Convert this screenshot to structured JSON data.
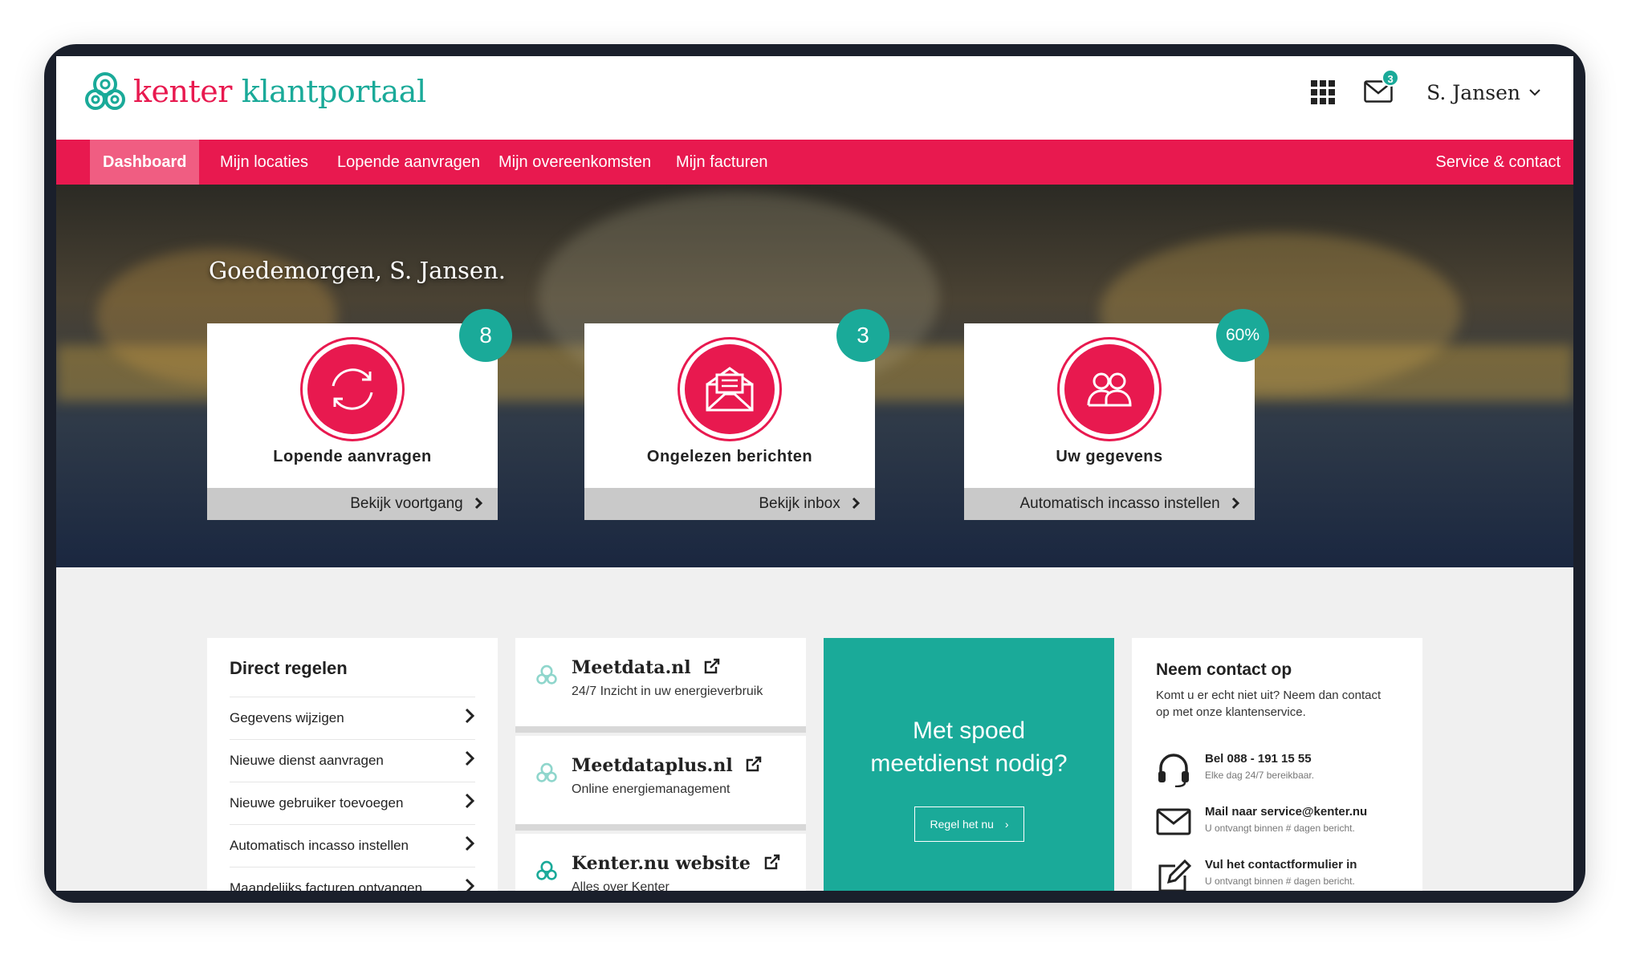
{
  "header": {
    "logo_part1": "kenter",
    "logo_part2": "klantportaal",
    "mail_count": "3",
    "user_name": "S. Jansen"
  },
  "nav": {
    "items": [
      "Dashboard",
      "Mijn locaties",
      "Lopende aanvragen",
      "Mijn overeenkomsten",
      "Mijn facturen"
    ],
    "service": "Service & contact"
  },
  "hero": {
    "greeting": "Goedemorgen, S. Jansen.",
    "cards": [
      {
        "title": "Lopende aanvragen",
        "link": "Bekijk voortgang",
        "badge": "8",
        "icon": "refresh-icon"
      },
      {
        "title": "Ongelezen berichten",
        "link": "Bekijk inbox",
        "badge": "3",
        "icon": "envelope-open-icon"
      },
      {
        "title": "Uw gegevens",
        "link": "Automatisch incasso instellen",
        "badge": "60%",
        "icon": "users-icon"
      }
    ]
  },
  "direct": {
    "title": "Direct regelen",
    "items": [
      "Gegevens wijzigen",
      "Nieuwe dienst aanvragen",
      "Nieuwe gebruiker toevoegen",
      "Automatisch incasso instellen",
      "Maandelijks facturen ontvangen"
    ]
  },
  "links": [
    {
      "title": "Meetdata.nl",
      "sub": "24/7 Inzicht in uw energieverbruik"
    },
    {
      "title": "Meetdataplus.nl",
      "sub": "Online energiemanagement"
    },
    {
      "title": "Kenter.nu website",
      "sub": "Alles over Kenter"
    }
  ],
  "spoed": {
    "line1": "Met spoed",
    "line2": "meetdienst nodig?",
    "button": "Regel het nu"
  },
  "contact": {
    "title": "Neem contact op",
    "sub": "Komt u er echt niet uit? Neem dan contact op met onze klantenservice.",
    "rows": [
      {
        "h": "Bel 088 - 191 15 55",
        "s": "Elke dag 24/7 bereikbaar."
      },
      {
        "h": "Mail naar service@kenter.nu",
        "s": "U ontvangt binnen # dagen bericht."
      },
      {
        "h": "Vul het contactformulier in",
        "s": "U ontvangt binnen # dagen bericht."
      }
    ]
  },
  "colors": {
    "brand_pink": "#e8194f",
    "brand_teal": "#1aaa99"
  }
}
